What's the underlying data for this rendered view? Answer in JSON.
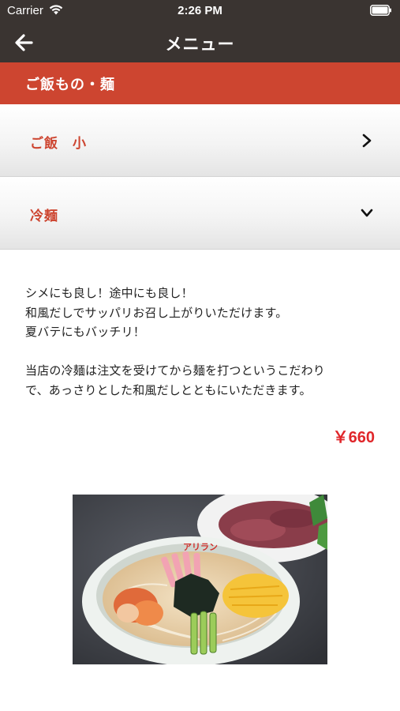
{
  "status_bar": {
    "carrier": "Carrier",
    "time": "2:26 PM"
  },
  "nav": {
    "back_icon": "arrow-left-icon",
    "title": "メニュー"
  },
  "category": {
    "title": "ご飯もの・麺"
  },
  "accordion": [
    {
      "label": "ご飯　小",
      "icon": "chevron-right-icon",
      "expanded": false
    },
    {
      "label": "冷麺",
      "icon": "chevron-down-icon",
      "expanded": true
    }
  ],
  "detail": {
    "description": [
      "シメにも良し！途中にも良し！",
      "和風だしでサッパリお召し上がりいただけます。",
      "夏バテにもバッチリ！",
      "",
      "当店の冷麺は注文を受けてから麺を打つというこだわり",
      "で、あっさりとした和風だしとともにいただきます。"
    ],
    "price": "￥660",
    "photo": {
      "bowl_text": "アリラン"
    }
  },
  "colors": {
    "header": "#3a3431",
    "accent": "#cd4530",
    "price": "#e0262a"
  }
}
